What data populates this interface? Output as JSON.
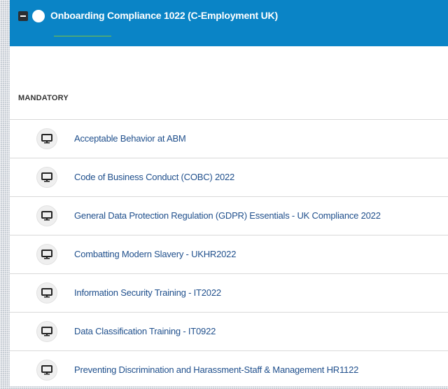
{
  "header": {
    "title": "Onboarding Compliance 1022 (C-Employment UK)",
    "icons": {
      "collapse": "minus-square-icon",
      "status": "status-circle-icon"
    },
    "accent_color": "#0a84c6",
    "progress_color": "#7cc242"
  },
  "section": {
    "label": "MANDATORY"
  },
  "courses": [
    {
      "label": "Acceptable Behavior at ABM",
      "icon": "monitor-icon"
    },
    {
      "label": "Code of Business Conduct (COBC) 2022",
      "icon": "monitor-icon"
    },
    {
      "label": "General Data Protection Regulation (GDPR) Essentials - UK Compliance 2022",
      "icon": "monitor-icon"
    },
    {
      "label": "Combatting Modern Slavery - UKHR2022",
      "icon": "monitor-icon"
    },
    {
      "label": "Information Security Training - IT2022",
      "icon": "monitor-icon"
    },
    {
      "label": "Data Classification Training - IT0922",
      "icon": "monitor-icon"
    },
    {
      "label": "Preventing Discrimination and Harassment-Staff & Management HR1122",
      "icon": "monitor-icon"
    }
  ]
}
